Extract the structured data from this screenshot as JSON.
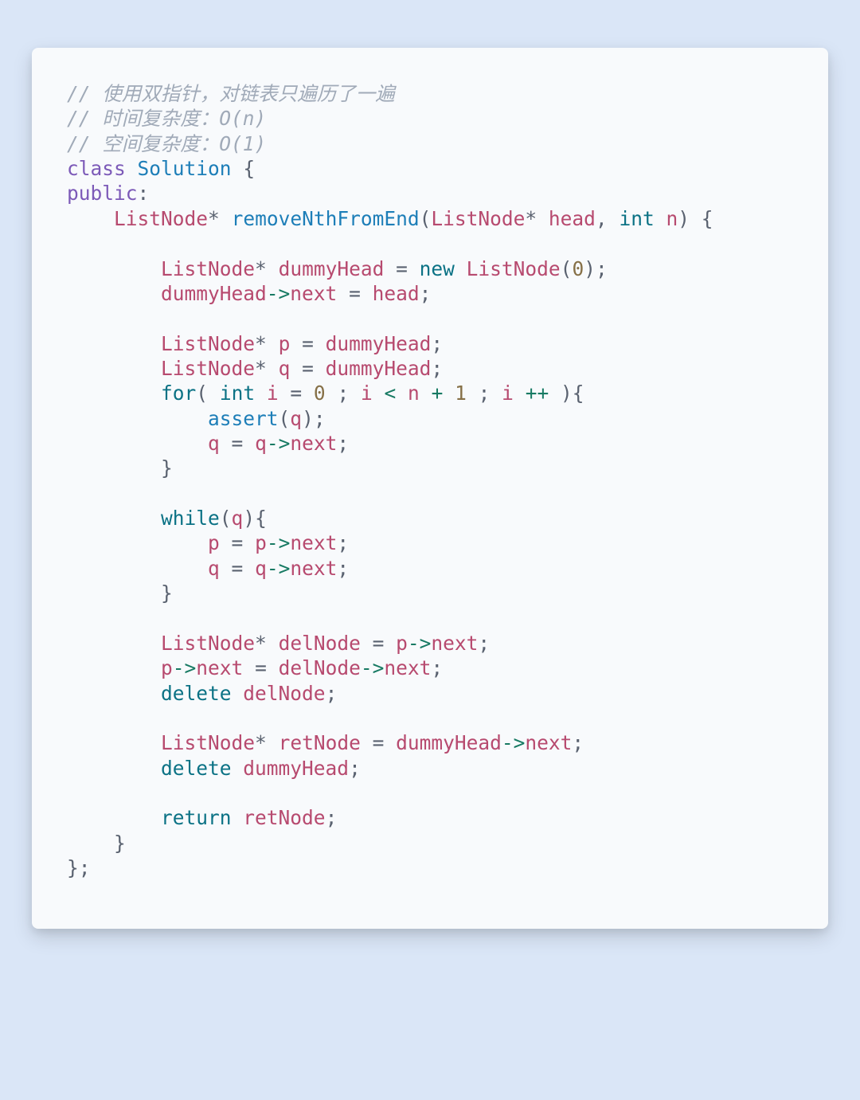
{
  "code": {
    "comment1": "// 使用双指针，对链表只遍历了一遍",
    "comment2": "// 时间复杂度：O(n)",
    "comment3": "// 空间复杂度：O(1)",
    "kw_class": "class",
    "cls_name": "Solution",
    "brace_open": "{",
    "kw_public": "public",
    "colon": ":",
    "type_listnode": "ListNode",
    "star": "*",
    "fn_remove": "removeNthFromEnd",
    "paren_open": "(",
    "paren_close": ")",
    "id_head": "head",
    "comma": ",",
    "kw_int": "int",
    "id_n": "n",
    "id_dummyHead": "dummyHead",
    "op_assign": "=",
    "kw_new": "new",
    "num_0": "0",
    "semi": ";",
    "arrow": "->",
    "id_next": "next",
    "id_p": "p",
    "id_q": "q",
    "kw_for": "for",
    "id_i": "i",
    "op_lt": "<",
    "op_plus": "+",
    "num_1": "1",
    "op_pp": "++",
    "fn_assert": "assert",
    "brace_close": "}",
    "kw_while": "while",
    "id_delNode": "delNode",
    "kw_delete": "delete",
    "id_retNode": "retNode",
    "kw_return": "return",
    "end_brace_semi": "};",
    "sp1": " ",
    "sp4": "    ",
    "sp8": "        ",
    "sp12": "            "
  }
}
